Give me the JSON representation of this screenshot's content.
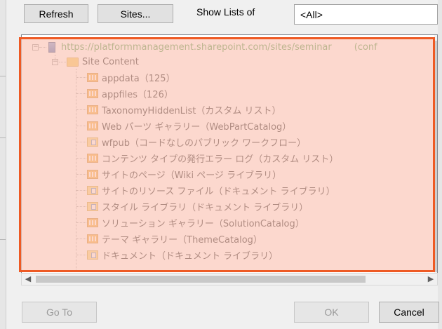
{
  "toolbar": {
    "refresh_label": "Refresh",
    "sites_label": "Sites...",
    "show_lists_label": "Show Lists of",
    "show_lists_value": "<All>"
  },
  "tree": {
    "root": {
      "url": "https://platformmanagement.sharepoint.com/sites/seminar",
      "suffix": "(conf"
    },
    "site_content_label": "Site Content",
    "items": [
      {
        "icon": "list-icon",
        "label": "appdata（125）"
      },
      {
        "icon": "list-icon",
        "label": "appfiles（126）"
      },
      {
        "icon": "list-icon",
        "label": "TaxonomyHiddenList（カスタム リスト）"
      },
      {
        "icon": "list-icon",
        "label": "Web パーツ ギャラリー（WebPartCatalog）"
      },
      {
        "icon": "library-icon",
        "label": "wfpub（コードなしのパブリック ワークフロー）"
      },
      {
        "icon": "list-icon",
        "label": "コンテンツ タイプの発行エラー ログ（カスタム リスト）"
      },
      {
        "icon": "list-icon",
        "label": "サイトのページ（Wiki ページ ライブラリ）"
      },
      {
        "icon": "library-icon",
        "label": "サイトのリソース ファイル（ドキュメント ライブラリ）"
      },
      {
        "icon": "library-icon",
        "label": "スタイル ライブラリ（ドキュメント ライブラリ）"
      },
      {
        "icon": "list-icon",
        "label": "ソリューション ギャラリー（SolutionCatalog）"
      },
      {
        "icon": "list-icon",
        "label": "テーマ ギャラリー（ThemeCatalog）"
      },
      {
        "icon": "library-icon",
        "label": "ドキュメント（ドキュメント ライブラリ）"
      }
    ]
  },
  "footer": {
    "goto_label": "Go To",
    "ok_label": "OK",
    "cancel_label": "Cancel"
  },
  "colors": {
    "highlight_border": "#ee5a24",
    "highlight_fill": "#fbc8b9",
    "url_green": "#2e8b2e"
  }
}
